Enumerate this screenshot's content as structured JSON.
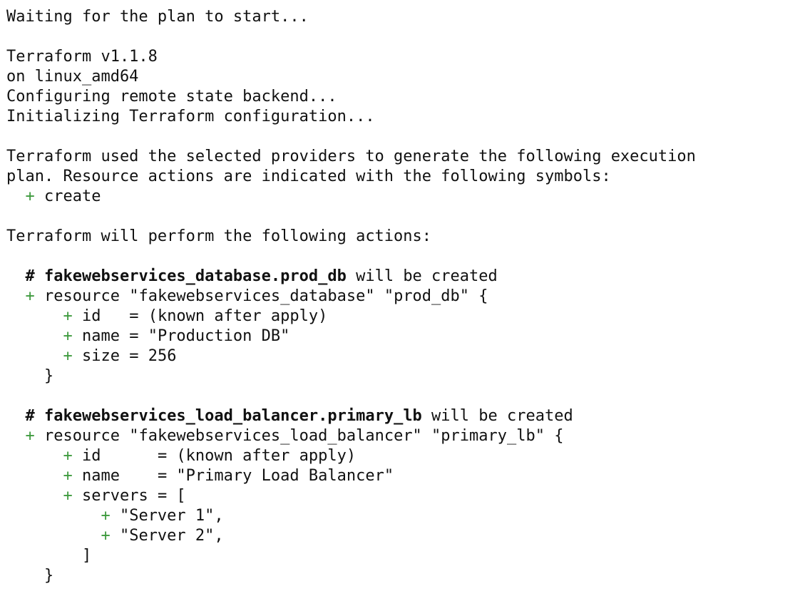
{
  "colors": {
    "background": "#ffffff",
    "text": "#111111",
    "plus": "#3e9a3e"
  },
  "lines": {
    "waiting": "Waiting for the plan to start...",
    "version": "Terraform v1.1.8",
    "platform": "on linux_amd64",
    "configuring": "Configuring remote state backend...",
    "initializing": "Initializing Terraform configuration...",
    "plan_intro_1": "Terraform used the selected providers to generate the following execution",
    "plan_intro_2": "plan. Resource actions are indicated with the following symbols:",
    "symbol_create": "create",
    "perform": "Terraform will perform the following actions:"
  },
  "resources": [
    {
      "comment_hash": "#",
      "address": "fakewebservices_database.prod_db",
      "comment_suffix": " will be created",
      "declaration": "resource \"fakewebservices_database\" \"prod_db\" {",
      "attrs": [
        "id   = (known after apply)",
        "name = \"Production DB\"",
        "size = 256"
      ],
      "close": "}"
    },
    {
      "comment_hash": "#",
      "address": "fakewebservices_load_balancer.primary_lb",
      "comment_suffix": " will be created",
      "declaration": "resource \"fakewebservices_load_balancer\" \"primary_lb\" {",
      "attrs": [
        "id      = (known after apply)",
        "name    = \"Primary Load Balancer\"",
        "servers = ["
      ],
      "list_items": [
        "\"Server 1\",",
        "\"Server 2\","
      ],
      "list_close": "]",
      "close": "}"
    }
  ]
}
